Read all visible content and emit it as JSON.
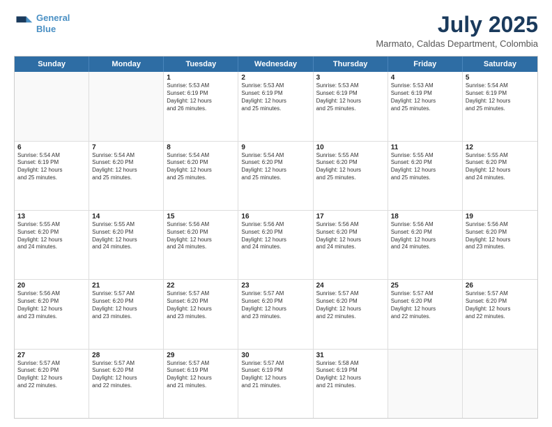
{
  "logo": {
    "line1": "General",
    "line2": "Blue"
  },
  "title": "July 2025",
  "subtitle": "Marmato, Caldas Department, Colombia",
  "days": [
    "Sunday",
    "Monday",
    "Tuesday",
    "Wednesday",
    "Thursday",
    "Friday",
    "Saturday"
  ],
  "weeks": [
    [
      {
        "day": "",
        "info": ""
      },
      {
        "day": "",
        "info": ""
      },
      {
        "day": "1",
        "info": "Sunrise: 5:53 AM\nSunset: 6:19 PM\nDaylight: 12 hours\nand 26 minutes."
      },
      {
        "day": "2",
        "info": "Sunrise: 5:53 AM\nSunset: 6:19 PM\nDaylight: 12 hours\nand 25 minutes."
      },
      {
        "day": "3",
        "info": "Sunrise: 5:53 AM\nSunset: 6:19 PM\nDaylight: 12 hours\nand 25 minutes."
      },
      {
        "day": "4",
        "info": "Sunrise: 5:53 AM\nSunset: 6:19 PM\nDaylight: 12 hours\nand 25 minutes."
      },
      {
        "day": "5",
        "info": "Sunrise: 5:54 AM\nSunset: 6:19 PM\nDaylight: 12 hours\nand 25 minutes."
      }
    ],
    [
      {
        "day": "6",
        "info": "Sunrise: 5:54 AM\nSunset: 6:19 PM\nDaylight: 12 hours\nand 25 minutes."
      },
      {
        "day": "7",
        "info": "Sunrise: 5:54 AM\nSunset: 6:20 PM\nDaylight: 12 hours\nand 25 minutes."
      },
      {
        "day": "8",
        "info": "Sunrise: 5:54 AM\nSunset: 6:20 PM\nDaylight: 12 hours\nand 25 minutes."
      },
      {
        "day": "9",
        "info": "Sunrise: 5:54 AM\nSunset: 6:20 PM\nDaylight: 12 hours\nand 25 minutes."
      },
      {
        "day": "10",
        "info": "Sunrise: 5:55 AM\nSunset: 6:20 PM\nDaylight: 12 hours\nand 25 minutes."
      },
      {
        "day": "11",
        "info": "Sunrise: 5:55 AM\nSunset: 6:20 PM\nDaylight: 12 hours\nand 25 minutes."
      },
      {
        "day": "12",
        "info": "Sunrise: 5:55 AM\nSunset: 6:20 PM\nDaylight: 12 hours\nand 24 minutes."
      }
    ],
    [
      {
        "day": "13",
        "info": "Sunrise: 5:55 AM\nSunset: 6:20 PM\nDaylight: 12 hours\nand 24 minutes."
      },
      {
        "day": "14",
        "info": "Sunrise: 5:55 AM\nSunset: 6:20 PM\nDaylight: 12 hours\nand 24 minutes."
      },
      {
        "day": "15",
        "info": "Sunrise: 5:56 AM\nSunset: 6:20 PM\nDaylight: 12 hours\nand 24 minutes."
      },
      {
        "day": "16",
        "info": "Sunrise: 5:56 AM\nSunset: 6:20 PM\nDaylight: 12 hours\nand 24 minutes."
      },
      {
        "day": "17",
        "info": "Sunrise: 5:56 AM\nSunset: 6:20 PM\nDaylight: 12 hours\nand 24 minutes."
      },
      {
        "day": "18",
        "info": "Sunrise: 5:56 AM\nSunset: 6:20 PM\nDaylight: 12 hours\nand 24 minutes."
      },
      {
        "day": "19",
        "info": "Sunrise: 5:56 AM\nSunset: 6:20 PM\nDaylight: 12 hours\nand 23 minutes."
      }
    ],
    [
      {
        "day": "20",
        "info": "Sunrise: 5:56 AM\nSunset: 6:20 PM\nDaylight: 12 hours\nand 23 minutes."
      },
      {
        "day": "21",
        "info": "Sunrise: 5:57 AM\nSunset: 6:20 PM\nDaylight: 12 hours\nand 23 minutes."
      },
      {
        "day": "22",
        "info": "Sunrise: 5:57 AM\nSunset: 6:20 PM\nDaylight: 12 hours\nand 23 minutes."
      },
      {
        "day": "23",
        "info": "Sunrise: 5:57 AM\nSunset: 6:20 PM\nDaylight: 12 hours\nand 23 minutes."
      },
      {
        "day": "24",
        "info": "Sunrise: 5:57 AM\nSunset: 6:20 PM\nDaylight: 12 hours\nand 22 minutes."
      },
      {
        "day": "25",
        "info": "Sunrise: 5:57 AM\nSunset: 6:20 PM\nDaylight: 12 hours\nand 22 minutes."
      },
      {
        "day": "26",
        "info": "Sunrise: 5:57 AM\nSunset: 6:20 PM\nDaylight: 12 hours\nand 22 minutes."
      }
    ],
    [
      {
        "day": "27",
        "info": "Sunrise: 5:57 AM\nSunset: 6:20 PM\nDaylight: 12 hours\nand 22 minutes."
      },
      {
        "day": "28",
        "info": "Sunrise: 5:57 AM\nSunset: 6:20 PM\nDaylight: 12 hours\nand 22 minutes."
      },
      {
        "day": "29",
        "info": "Sunrise: 5:57 AM\nSunset: 6:19 PM\nDaylight: 12 hours\nand 21 minutes."
      },
      {
        "day": "30",
        "info": "Sunrise: 5:57 AM\nSunset: 6:19 PM\nDaylight: 12 hours\nand 21 minutes."
      },
      {
        "day": "31",
        "info": "Sunrise: 5:58 AM\nSunset: 6:19 PM\nDaylight: 12 hours\nand 21 minutes."
      },
      {
        "day": "",
        "info": ""
      },
      {
        "day": "",
        "info": ""
      }
    ]
  ]
}
